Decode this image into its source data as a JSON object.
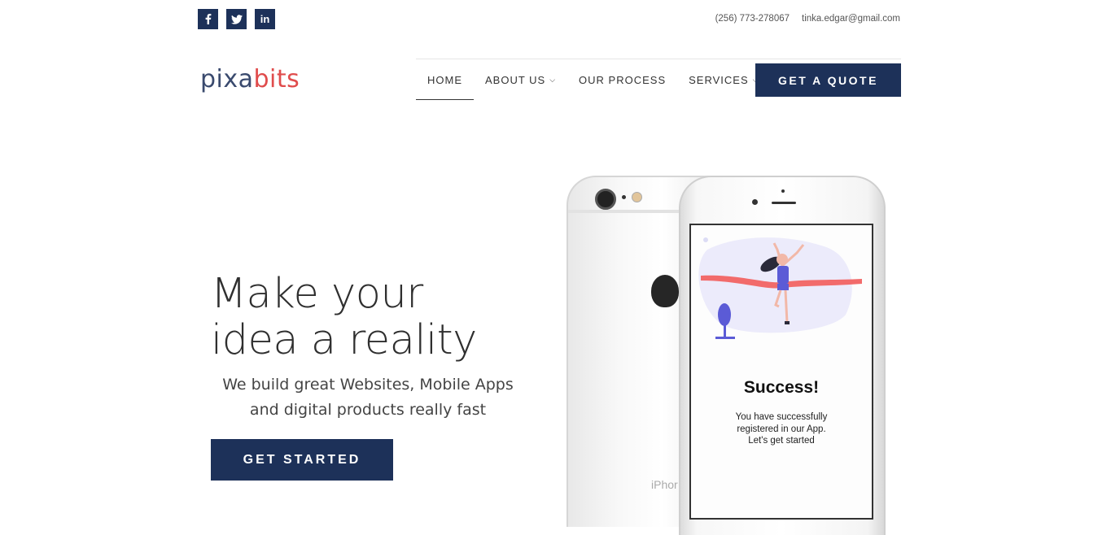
{
  "topbar": {
    "social": [
      {
        "icon": "facebook-icon",
        "glyph": "f"
      },
      {
        "icon": "twitter-icon",
        "glyph": ""
      },
      {
        "icon": "linkedin-icon",
        "glyph": "in"
      }
    ],
    "phone": "(256) 773-278067",
    "email": "tinka.edgar@gmail.com"
  },
  "logo": {
    "part1": "pixa",
    "part2": "bits"
  },
  "nav": {
    "items": [
      {
        "label": "HOME",
        "active": true,
        "dropdown": false
      },
      {
        "label": "ABOUT US",
        "dropdown": true
      },
      {
        "label": "OUR PROCESS",
        "dropdown": false
      },
      {
        "label": "SERVICES",
        "dropdown": true
      }
    ],
    "caret": "⌄",
    "cta": "GET A QUOTE"
  },
  "hero": {
    "headline_line1": "Make your",
    "headline_line2": "idea a reality",
    "sub_line1": "We build great Websites, Mobile Apps",
    "sub_line2": "and digital products really fast",
    "button": "GET STARTED"
  },
  "phone_mockup": {
    "back_label": "iPhor",
    "success_title": "Success!",
    "success_line1": "You have successfully",
    "success_line2": "registered in our App.",
    "success_line3": "Let's get started"
  },
  "colors": {
    "brand": "#1d3159",
    "accent": "#e04c4c",
    "ribbon": "#f26b6b",
    "figure": "#5b5bd6"
  }
}
